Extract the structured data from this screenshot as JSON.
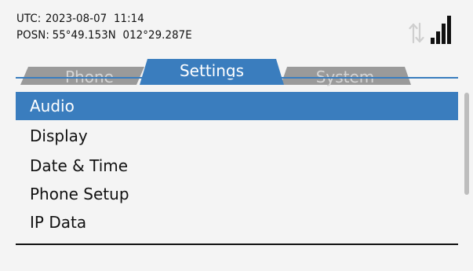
{
  "status": {
    "utc_label": "UTC:",
    "utc_value": "2023-08-07  11:14",
    "posn_label": "POSN:",
    "posn_value": "55°49.153N  012°29.287E",
    "signal_bars": 4
  },
  "tabs": [
    {
      "label": "Phone",
      "active": false
    },
    {
      "label": "Settings",
      "active": true
    },
    {
      "label": "System",
      "active": false
    }
  ],
  "menu": {
    "items": [
      {
        "label": "Audio",
        "selected": true
      },
      {
        "label": "Display",
        "selected": false
      },
      {
        "label": "Date & Time",
        "selected": false
      },
      {
        "label": "Phone Setup",
        "selected": false
      },
      {
        "label": "IP Data",
        "selected": false
      }
    ]
  },
  "colors": {
    "accent": "#3a7dbe",
    "inactive_tab": "#9a9a9a",
    "inactive_tab_text": "#d6d6d6",
    "background": "#f4f4f4"
  }
}
